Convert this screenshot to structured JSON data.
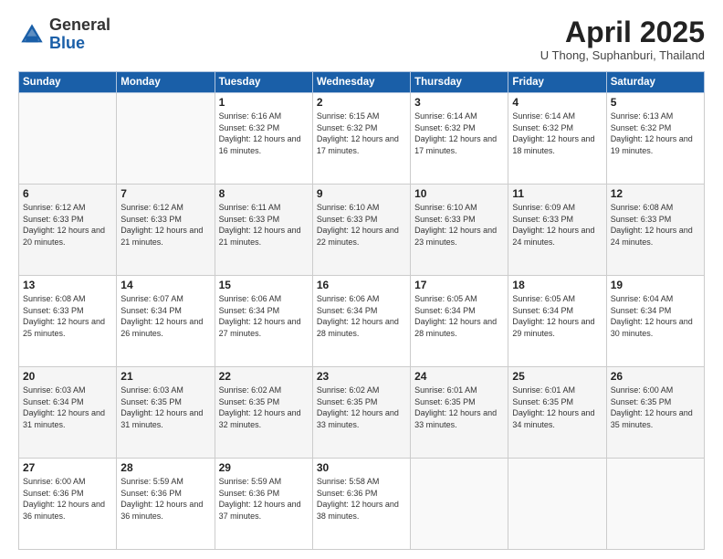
{
  "header": {
    "logo_general": "General",
    "logo_blue": "Blue",
    "month_title": "April 2025",
    "location": "U Thong, Suphanburi, Thailand"
  },
  "days_of_week": [
    "Sunday",
    "Monday",
    "Tuesday",
    "Wednesday",
    "Thursday",
    "Friday",
    "Saturday"
  ],
  "weeks": [
    {
      "shaded": false,
      "days": [
        {
          "num": "",
          "info": ""
        },
        {
          "num": "",
          "info": ""
        },
        {
          "num": "1",
          "info": "Sunrise: 6:16 AM\nSunset: 6:32 PM\nDaylight: 12 hours and 16 minutes."
        },
        {
          "num": "2",
          "info": "Sunrise: 6:15 AM\nSunset: 6:32 PM\nDaylight: 12 hours and 17 minutes."
        },
        {
          "num": "3",
          "info": "Sunrise: 6:14 AM\nSunset: 6:32 PM\nDaylight: 12 hours and 17 minutes."
        },
        {
          "num": "4",
          "info": "Sunrise: 6:14 AM\nSunset: 6:32 PM\nDaylight: 12 hours and 18 minutes."
        },
        {
          "num": "5",
          "info": "Sunrise: 6:13 AM\nSunset: 6:32 PM\nDaylight: 12 hours and 19 minutes."
        }
      ]
    },
    {
      "shaded": true,
      "days": [
        {
          "num": "6",
          "info": "Sunrise: 6:12 AM\nSunset: 6:33 PM\nDaylight: 12 hours and 20 minutes."
        },
        {
          "num": "7",
          "info": "Sunrise: 6:12 AM\nSunset: 6:33 PM\nDaylight: 12 hours and 21 minutes."
        },
        {
          "num": "8",
          "info": "Sunrise: 6:11 AM\nSunset: 6:33 PM\nDaylight: 12 hours and 21 minutes."
        },
        {
          "num": "9",
          "info": "Sunrise: 6:10 AM\nSunset: 6:33 PM\nDaylight: 12 hours and 22 minutes."
        },
        {
          "num": "10",
          "info": "Sunrise: 6:10 AM\nSunset: 6:33 PM\nDaylight: 12 hours and 23 minutes."
        },
        {
          "num": "11",
          "info": "Sunrise: 6:09 AM\nSunset: 6:33 PM\nDaylight: 12 hours and 24 minutes."
        },
        {
          "num": "12",
          "info": "Sunrise: 6:08 AM\nSunset: 6:33 PM\nDaylight: 12 hours and 24 minutes."
        }
      ]
    },
    {
      "shaded": false,
      "days": [
        {
          "num": "13",
          "info": "Sunrise: 6:08 AM\nSunset: 6:33 PM\nDaylight: 12 hours and 25 minutes."
        },
        {
          "num": "14",
          "info": "Sunrise: 6:07 AM\nSunset: 6:34 PM\nDaylight: 12 hours and 26 minutes."
        },
        {
          "num": "15",
          "info": "Sunrise: 6:06 AM\nSunset: 6:34 PM\nDaylight: 12 hours and 27 minutes."
        },
        {
          "num": "16",
          "info": "Sunrise: 6:06 AM\nSunset: 6:34 PM\nDaylight: 12 hours and 28 minutes."
        },
        {
          "num": "17",
          "info": "Sunrise: 6:05 AM\nSunset: 6:34 PM\nDaylight: 12 hours and 28 minutes."
        },
        {
          "num": "18",
          "info": "Sunrise: 6:05 AM\nSunset: 6:34 PM\nDaylight: 12 hours and 29 minutes."
        },
        {
          "num": "19",
          "info": "Sunrise: 6:04 AM\nSunset: 6:34 PM\nDaylight: 12 hours and 30 minutes."
        }
      ]
    },
    {
      "shaded": true,
      "days": [
        {
          "num": "20",
          "info": "Sunrise: 6:03 AM\nSunset: 6:34 PM\nDaylight: 12 hours and 31 minutes."
        },
        {
          "num": "21",
          "info": "Sunrise: 6:03 AM\nSunset: 6:35 PM\nDaylight: 12 hours and 31 minutes."
        },
        {
          "num": "22",
          "info": "Sunrise: 6:02 AM\nSunset: 6:35 PM\nDaylight: 12 hours and 32 minutes."
        },
        {
          "num": "23",
          "info": "Sunrise: 6:02 AM\nSunset: 6:35 PM\nDaylight: 12 hours and 33 minutes."
        },
        {
          "num": "24",
          "info": "Sunrise: 6:01 AM\nSunset: 6:35 PM\nDaylight: 12 hours and 33 minutes."
        },
        {
          "num": "25",
          "info": "Sunrise: 6:01 AM\nSunset: 6:35 PM\nDaylight: 12 hours and 34 minutes."
        },
        {
          "num": "26",
          "info": "Sunrise: 6:00 AM\nSunset: 6:35 PM\nDaylight: 12 hours and 35 minutes."
        }
      ]
    },
    {
      "shaded": false,
      "days": [
        {
          "num": "27",
          "info": "Sunrise: 6:00 AM\nSunset: 6:36 PM\nDaylight: 12 hours and 36 minutes."
        },
        {
          "num": "28",
          "info": "Sunrise: 5:59 AM\nSunset: 6:36 PM\nDaylight: 12 hours and 36 minutes."
        },
        {
          "num": "29",
          "info": "Sunrise: 5:59 AM\nSunset: 6:36 PM\nDaylight: 12 hours and 37 minutes."
        },
        {
          "num": "30",
          "info": "Sunrise: 5:58 AM\nSunset: 6:36 PM\nDaylight: 12 hours and 38 minutes."
        },
        {
          "num": "",
          "info": ""
        },
        {
          "num": "",
          "info": ""
        },
        {
          "num": "",
          "info": ""
        }
      ]
    }
  ]
}
